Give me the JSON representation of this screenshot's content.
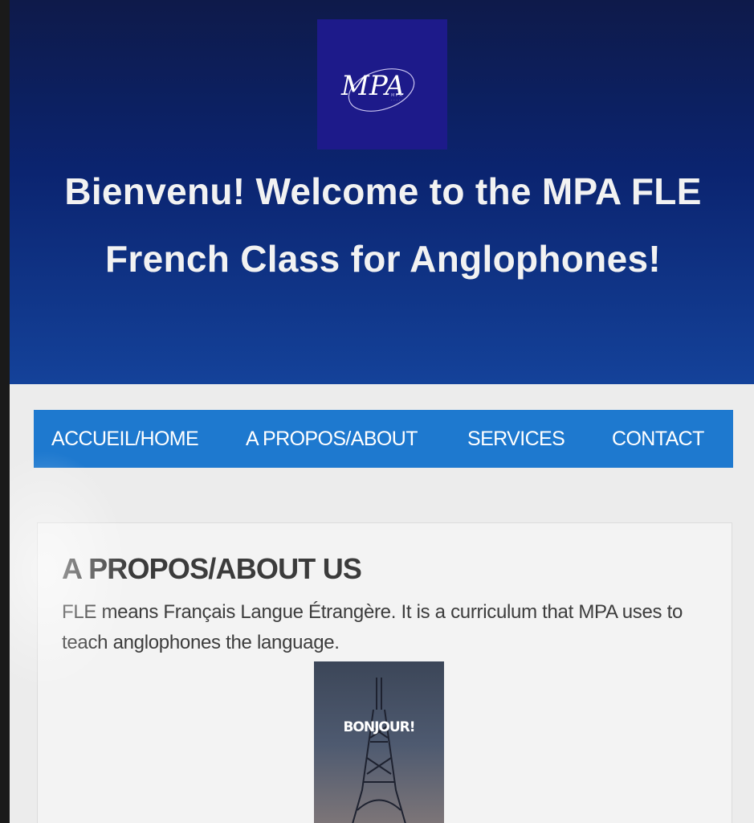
{
  "header": {
    "logo_text": "MPA",
    "title": "Bienvenu! Welcome to the MPA FLE French Class for Anglophones!"
  },
  "nav": {
    "items": [
      {
        "label": "ACCUEIL/HOME"
      },
      {
        "label": "A PROPOS/ABOUT"
      },
      {
        "label": "SERVICES"
      },
      {
        "label": "CONTACT"
      }
    ]
  },
  "about": {
    "title": "A PROPOS/ABOUT US",
    "text": "FLE means Français Langue Étrangère. It is a curriculum that MPA uses to teach anglophones the language.",
    "poster_text": "BONJOUR!"
  },
  "colors": {
    "header_dark": "#0e1a4a",
    "header_light": "#14429a",
    "logo_bg": "#1d1a8a",
    "nav_bg": "#1e79cf",
    "page_bg": "#ececec"
  }
}
